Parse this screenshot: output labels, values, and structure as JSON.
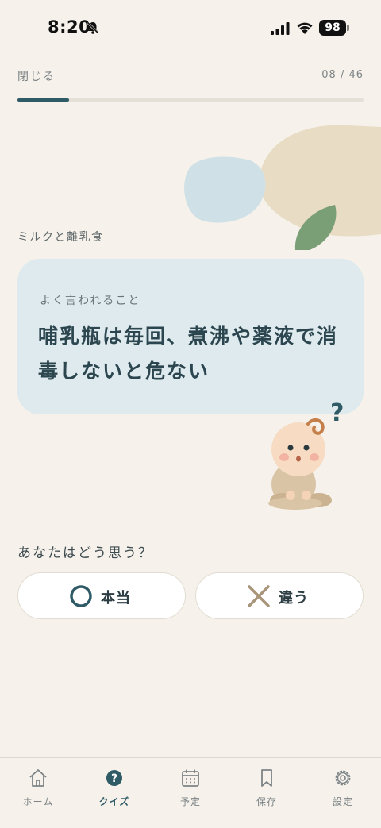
{
  "status_bar": {
    "time": "8:20",
    "battery": "98"
  },
  "header": {
    "close_label": "閉じる",
    "progress_text": "08 / 46",
    "progress_fraction": 0.15
  },
  "category": "ミルクと離乳食",
  "card": {
    "label": "よく言われること",
    "statement": "哺乳瓶は毎回、煮沸や薬液で消毒しないと危ない"
  },
  "question": "あなたはどう思う？",
  "answers": {
    "true_label": "本当",
    "false_label": "違う"
  },
  "tab_bar": {
    "items": [
      {
        "label": "ホーム",
        "icon": "home-icon"
      },
      {
        "label": "クイズ",
        "icon": "quiz-icon",
        "active": true
      },
      {
        "label": "予定",
        "icon": "calendar-icon"
      },
      {
        "label": "保存",
        "icon": "bookmark-icon"
      },
      {
        "label": "設定",
        "icon": "gear-icon"
      }
    ]
  },
  "colors": {
    "background": "#f6f2eb",
    "accent": "#2f5b66",
    "card": "#deeaed",
    "true_icon": "#2f5b66",
    "false_icon": "#a89478"
  }
}
